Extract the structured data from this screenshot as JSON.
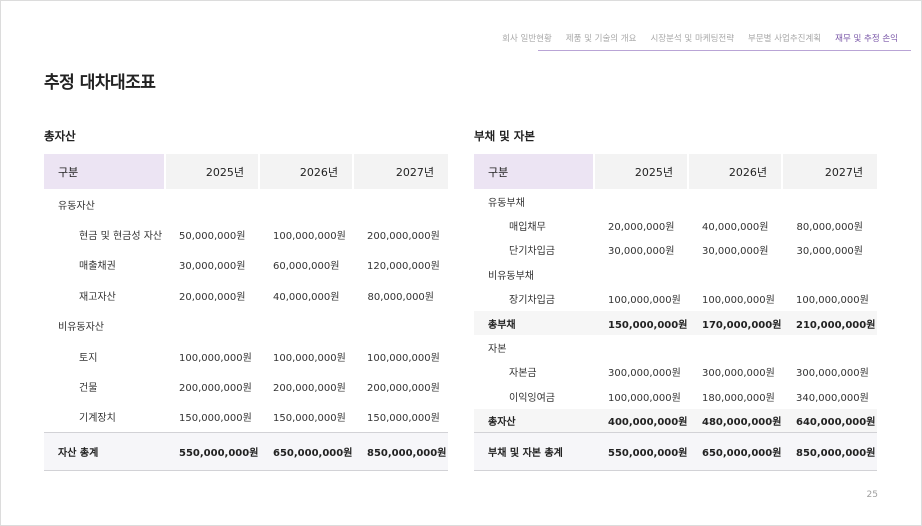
{
  "nav": {
    "items": [
      "회사 일반현황",
      "제품 및 기술의 개요",
      "시장분석 및 마케팅전략",
      "부문별 사업추진계획",
      "재무 및 추정 손익"
    ],
    "active_index": 4
  },
  "page_title": "추정 대차대조표",
  "assets": {
    "title": "총자산",
    "headers": [
      "구분",
      "2025년",
      "2026년",
      "2027년"
    ],
    "rows": [
      {
        "type": "cat",
        "label": "유동자산",
        "values": [
          "",
          "",
          ""
        ]
      },
      {
        "type": "sub",
        "label": "현금 및 현금성 자산",
        "values": [
          "50,000,000원",
          "100,000,000원",
          "200,000,000원"
        ]
      },
      {
        "type": "sub",
        "label": "매출채권",
        "values": [
          "30,000,000원",
          "60,000,000원",
          "120,000,000원"
        ]
      },
      {
        "type": "sub",
        "label": "재고자산",
        "values": [
          "20,000,000원",
          "40,000,000원",
          "80,000,000원"
        ]
      },
      {
        "type": "cat",
        "label": "비유동자산",
        "values": [
          "",
          "",
          ""
        ]
      },
      {
        "type": "sub",
        "label": "토지",
        "values": [
          "100,000,000원",
          "100,000,000원",
          "100,000,000원"
        ]
      },
      {
        "type": "sub",
        "label": "건물",
        "values": [
          "200,000,000원",
          "200,000,000원",
          "200,000,000원"
        ]
      },
      {
        "type": "sub",
        "label": "기계장치",
        "values": [
          "150,000,000원",
          "150,000,000원",
          "150,000,000원"
        ]
      },
      {
        "type": "total",
        "label": "자산 총계",
        "values": [
          "550,000,000원",
          "650,000,000원",
          "850,000,000원"
        ]
      }
    ]
  },
  "liabilities": {
    "title": "부채 및 자본",
    "headers": [
      "구분",
      "2025년",
      "2026년",
      "2027년"
    ],
    "rows": [
      {
        "type": "cat",
        "label": "유동부채",
        "values": [
          "",
          "",
          ""
        ]
      },
      {
        "type": "sub",
        "label": "매입채무",
        "values": [
          "20,000,000원",
          "40,000,000원",
          "80,000,000원"
        ]
      },
      {
        "type": "sub",
        "label": "단기차입금",
        "values": [
          "30,000,000원",
          "30,000,000원",
          "30,000,000원"
        ]
      },
      {
        "type": "cat",
        "label": "비유동부채",
        "values": [
          "",
          "",
          ""
        ]
      },
      {
        "type": "sub",
        "label": "장기차입금",
        "values": [
          "100,000,000원",
          "100,000,000원",
          "100,000,000원"
        ]
      },
      {
        "type": "strong",
        "label": "총부채",
        "values": [
          "150,000,000원",
          "170,000,000원",
          "210,000,000원"
        ]
      },
      {
        "type": "cat",
        "label": "자본",
        "values": [
          "",
          "",
          ""
        ]
      },
      {
        "type": "sub",
        "label": "자본금",
        "values": [
          "300,000,000원",
          "300,000,000원",
          "300,000,000원"
        ]
      },
      {
        "type": "sub",
        "label": "이익잉여금",
        "values": [
          "100,000,000원",
          "180,000,000원",
          "340,000,000원"
        ]
      },
      {
        "type": "strong",
        "label": "총자산",
        "values": [
          "400,000,000원",
          "480,000,000원",
          "640,000,000원"
        ]
      },
      {
        "type": "total",
        "label": "부채 및 자본 총계",
        "values": [
          "550,000,000원",
          "650,000,000원",
          "850,000,000원"
        ]
      }
    ]
  },
  "page_number": "25",
  "colors": {
    "accent": "#7a57a8",
    "header_first": "#ece4f3",
    "header": "#f3f3f3"
  }
}
